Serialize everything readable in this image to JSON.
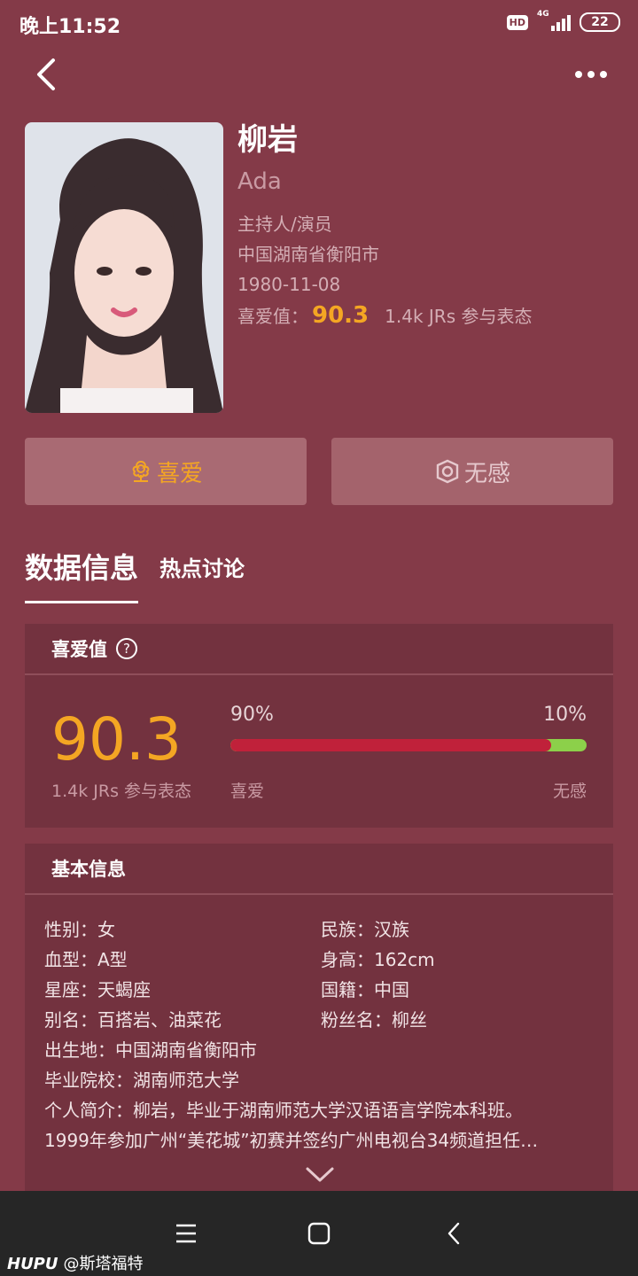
{
  "status_bar": {
    "time": "晚上11:52",
    "hd": "HD",
    "network": "4G",
    "battery": "22"
  },
  "profile": {
    "name": "柳岩",
    "english_name": "Ada",
    "occupation": "主持人/演员",
    "birthplace": "中国湖南省衡阳市",
    "birthday": "1980-11-08",
    "score_label": "喜爱值：",
    "score": "90.3",
    "participants": "1.4k JRs 参与表态"
  },
  "actions": {
    "like_label": "喜爱",
    "dislike_label": "无感"
  },
  "tabs": [
    {
      "label": "数据信息"
    },
    {
      "label": "热点讨论"
    }
  ],
  "love_card": {
    "title": "喜爱值",
    "help": "?",
    "score": "90.3",
    "participants": "1.4k JRs 参与表态",
    "like_percent_text": "90%",
    "dislike_percent_text": "10%",
    "like_fraction": 0.9,
    "like_label": "喜爱",
    "dislike_label": "无感"
  },
  "basic_info": {
    "title": "基本信息",
    "gender": "性别：女",
    "ethnicity": "民族：汉族",
    "blood_type": "血型：A型",
    "height": "身高：162cm",
    "zodiac": "星座：天蝎座",
    "nationality": "国籍：中国",
    "alias": "别名：百搭岩、油菜花",
    "fan_name": "粉丝名：柳丝",
    "birthplace": "出生地：中国湖南省衡阳市",
    "school": "毕业院校：湖南师范大学",
    "bio_line1": "个人简介：柳岩，毕业于湖南师范大学汉语语言学院本科班。",
    "bio_line2": "1999年参加广州“美花城”初赛并签约广州电视台34频道担任…"
  },
  "watermark": {
    "brand": "HUPU",
    "user": "@斯塔福特"
  },
  "colors": {
    "background": "#843a48",
    "accent": "#f4a623",
    "like_bar": "#c0213a",
    "dislike_bar": "#8cd04a"
  }
}
